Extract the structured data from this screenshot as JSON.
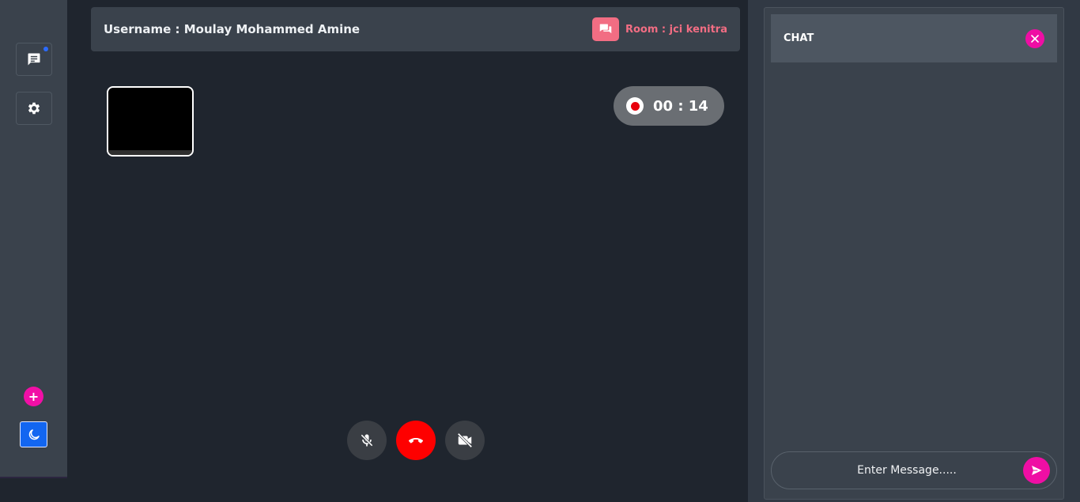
{
  "sidebar": {
    "chat_icon": "chat-bubble-icon",
    "settings_icon": "gear-icon",
    "add_label": "+",
    "theme_icon": "moon-icon"
  },
  "header": {
    "username_label": "Username : Moulay Mohammed Amine",
    "room_label": "Room : jci kenitra",
    "room_icon": "chat-bubbles-icon"
  },
  "call": {
    "timer": "00 : 14",
    "controls": [
      "mic-off-icon",
      "end-call-icon",
      "video-off-icon"
    ]
  },
  "chat": {
    "title": "CHAT",
    "input_placeholder": "Enter Message.....",
    "send_icon": "send-icon"
  },
  "colors": {
    "accent_pink": "#ef0ea4",
    "end_call_red": "#fe0000",
    "room_pink": "#f26d83",
    "theme_blue": "#1266f1"
  }
}
